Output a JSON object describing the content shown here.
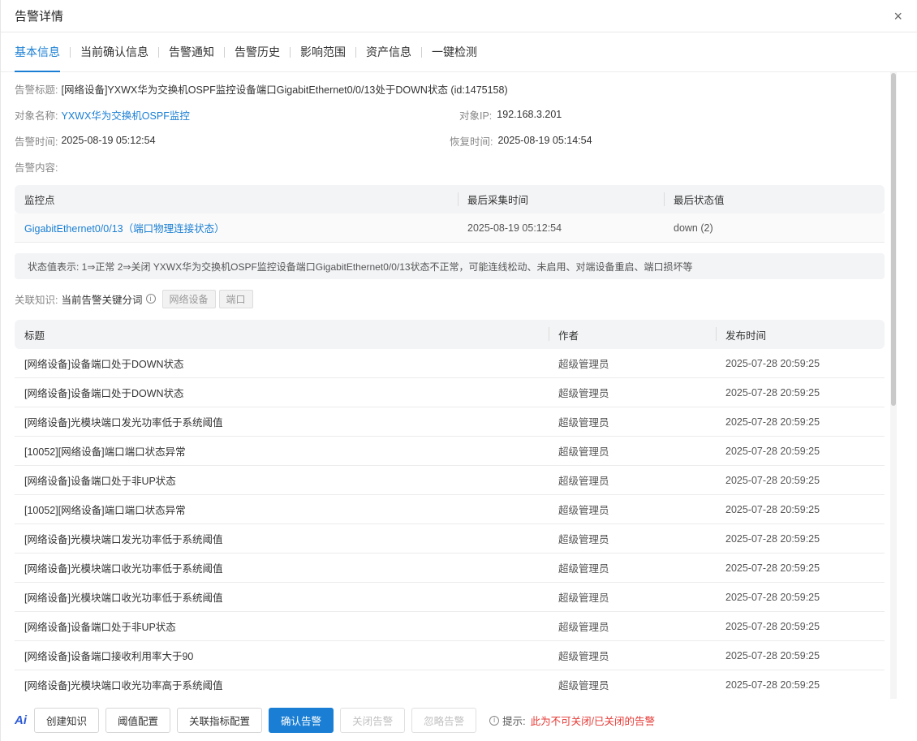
{
  "dialog": {
    "title": "告警详情",
    "close_label": "×"
  },
  "tabs": [
    {
      "label": "基本信息",
      "active": true
    },
    {
      "label": "当前确认信息"
    },
    {
      "label": "告警通知"
    },
    {
      "label": "告警历史"
    },
    {
      "label": "影响范围"
    },
    {
      "label": "资产信息"
    },
    {
      "label": "一键检测"
    }
  ],
  "info": {
    "title_label": "告警标题:",
    "title_value": "[网络设备]YXWX华为交换机OSPF监控设备端口GigabitEthernet0/0/13处于DOWN状态 (id:1475158)",
    "object_name_label": "对象名称:",
    "object_name_value": "YXWX华为交换机OSPF监控",
    "object_ip_label": "对象IP:",
    "object_ip_value": "192.168.3.201",
    "alarm_time_label": "告警时间:",
    "alarm_time_value": "2025-08-19 05:12:54",
    "recover_time_label": "恢复时间:",
    "recover_time_value": "2025-08-19 05:14:54",
    "content_label": "告警内容:"
  },
  "monitor_table": {
    "headers": [
      "监控点",
      "最后采集时间",
      "最后状态值"
    ],
    "rows": [
      [
        "GigabitEthernet0/0/13（端口物理连接状态）",
        "2025-08-19 05:12:54",
        "down (2)"
      ]
    ]
  },
  "status_note": "状态值表示: 1⇒正常 2⇒关闭 YXWX华为交换机OSPF监控设备端口GigabitEthernet0/0/13状态不正常，可能连线松动、未启用、对端设备重启、端口损坏等",
  "knowledge": {
    "label": "关联知识:",
    "keyword_label": "当前告警关键分词",
    "info_icon": "i",
    "tags": [
      "网络设备",
      "端口"
    ]
  },
  "knowledge_table": {
    "headers": [
      "标题",
      "作者",
      "发布时间"
    ],
    "rows": [
      [
        "[网络设备]设备端口处于DOWN状态",
        "超级管理员",
        "2025-07-28 20:59:25"
      ],
      [
        "[网络设备]设备端口处于DOWN状态",
        "超级管理员",
        "2025-07-28 20:59:25"
      ],
      [
        "[网络设备]光模块端口发光功率低于系统阈值",
        "超级管理员",
        "2025-07-28 20:59:25"
      ],
      [
        "[10052][网络设备]端口端口状态异常",
        "超级管理员",
        "2025-07-28 20:59:25"
      ],
      [
        "[网络设备]设备端口处于非UP状态",
        "超级管理员",
        "2025-07-28 20:59:25"
      ],
      [
        "[10052][网络设备]端口端口状态异常",
        "超级管理员",
        "2025-07-28 20:59:25"
      ],
      [
        "[网络设备]光模块端口发光功率低于系统阈值",
        "超级管理员",
        "2025-07-28 20:59:25"
      ],
      [
        "[网络设备]光模块端口收光功率低于系统阈值",
        "超级管理员",
        "2025-07-28 20:59:25"
      ],
      [
        "[网络设备]光模块端口收光功率低于系统阈值",
        "超级管理员",
        "2025-07-28 20:59:25"
      ],
      [
        "[网络设备]设备端口处于非UP状态",
        "超级管理员",
        "2025-07-28 20:59:25"
      ],
      [
        "[网络设备]设备端口接收利用率大于90",
        "超级管理员",
        "2025-07-28 20:59:25"
      ],
      [
        "[网络设备]光模块端口收光功率高于系统阈值",
        "超级管理员",
        "2025-07-28 20:59:25"
      ]
    ]
  },
  "footer": {
    "ai_label": "Ai",
    "buttons": {
      "create_knowledge": "创建知识",
      "threshold_config": "阈值配置",
      "related_metric_config": "关联指标配置",
      "confirm_alarm": "确认告警",
      "close_alarm": "关闭告警",
      "ignore_alarm": "忽略告警"
    },
    "tip_icon": "i",
    "tip_label": "提示:",
    "tip_warning": "此为不可关闭/已关闭的告警"
  },
  "colors": {
    "accent": "#1a7fd4",
    "warning": "#e53935",
    "header_bg": "#f3f4f6"
  }
}
